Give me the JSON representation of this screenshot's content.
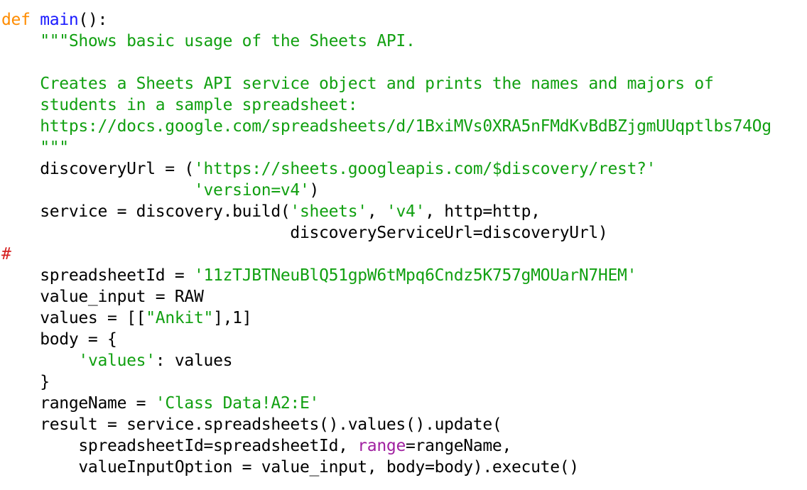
{
  "lines": [
    [
      {
        "t": "def",
        "c": "kw"
      },
      {
        "t": " ",
        "c": "plain"
      },
      {
        "t": "main",
        "c": "fn"
      },
      {
        "t": "():",
        "c": "plain"
      }
    ],
    [
      {
        "t": "    \"\"\"Shows basic usage of the Sheets API.",
        "c": "doc"
      }
    ],
    [],
    [
      {
        "t": "    Creates a Sheets API service object and prints the names and majors of",
        "c": "doc"
      }
    ],
    [
      {
        "t": "    students in a sample spreadsheet:",
        "c": "doc"
      }
    ],
    [
      {
        "t": "    https://docs.google.com/spreadsheets/d/1BxiMVs0XRA5nFMdKvBdBZjgmUUqptlbs74Og",
        "c": "doc"
      }
    ],
    [
      {
        "t": "    \"\"\"",
        "c": "doc"
      }
    ],
    [
      {
        "t": "    discoveryUrl = (",
        "c": "plain"
      },
      {
        "t": "'https://sheets.googleapis.com/$discovery/rest?'",
        "c": "str"
      }
    ],
    [
      {
        "t": "                    ",
        "c": "plain"
      },
      {
        "t": "'version=v4'",
        "c": "str"
      },
      {
        "t": ")",
        "c": "plain"
      }
    ],
    [
      {
        "t": "    service = discovery.build(",
        "c": "plain"
      },
      {
        "t": "'sheets'",
        "c": "str"
      },
      {
        "t": ", ",
        "c": "plain"
      },
      {
        "t": "'v4'",
        "c": "str"
      },
      {
        "t": ", http=http,",
        "c": "plain"
      }
    ],
    [
      {
        "t": "                              discoveryServiceUrl=discoveryUrl)",
        "c": "plain"
      }
    ],
    [
      {
        "t": "#",
        "c": "cmt"
      }
    ],
    [
      {
        "t": "    spreadsheetId = ",
        "c": "plain"
      },
      {
        "t": "'11zTJBTNeuBlQ51gpW6tMpq6Cndz5K757gMOUarN7HEM'",
        "c": "str"
      }
    ],
    [
      {
        "t": "    value_input = RAW",
        "c": "plain"
      }
    ],
    [
      {
        "t": "    values = [[",
        "c": "plain"
      },
      {
        "t": "\"Ankit\"",
        "c": "str"
      },
      {
        "t": "],1]",
        "c": "plain"
      }
    ],
    [
      {
        "t": "    body = {",
        "c": "plain"
      }
    ],
    [
      {
        "t": "        ",
        "c": "plain"
      },
      {
        "t": "'values'",
        "c": "str"
      },
      {
        "t": ": values",
        "c": "plain"
      }
    ],
    [
      {
        "t": "    }",
        "c": "plain"
      }
    ],
    [
      {
        "t": "    rangeName = ",
        "c": "plain"
      },
      {
        "t": "'Class Data!A2:E'",
        "c": "str"
      }
    ],
    [
      {
        "t": "    result = service.spreadsheets().values().update(",
        "c": "plain"
      }
    ],
    [
      {
        "t": "        spreadsheetId=spreadsheetId, ",
        "c": "plain"
      },
      {
        "t": "range",
        "c": "bi"
      },
      {
        "t": "=rangeName,",
        "c": "plain"
      }
    ],
    [
      {
        "t": "        valueInputOption = value_input, body=body).execute()",
        "c": "plain"
      }
    ]
  ],
  "colors": {
    "keyword": "#ff8c00",
    "function": "#1a1aff",
    "string": "#11a011",
    "comment": "#d62020",
    "builtin": "#a020a0",
    "text": "#000000",
    "background": "#ffffff"
  }
}
